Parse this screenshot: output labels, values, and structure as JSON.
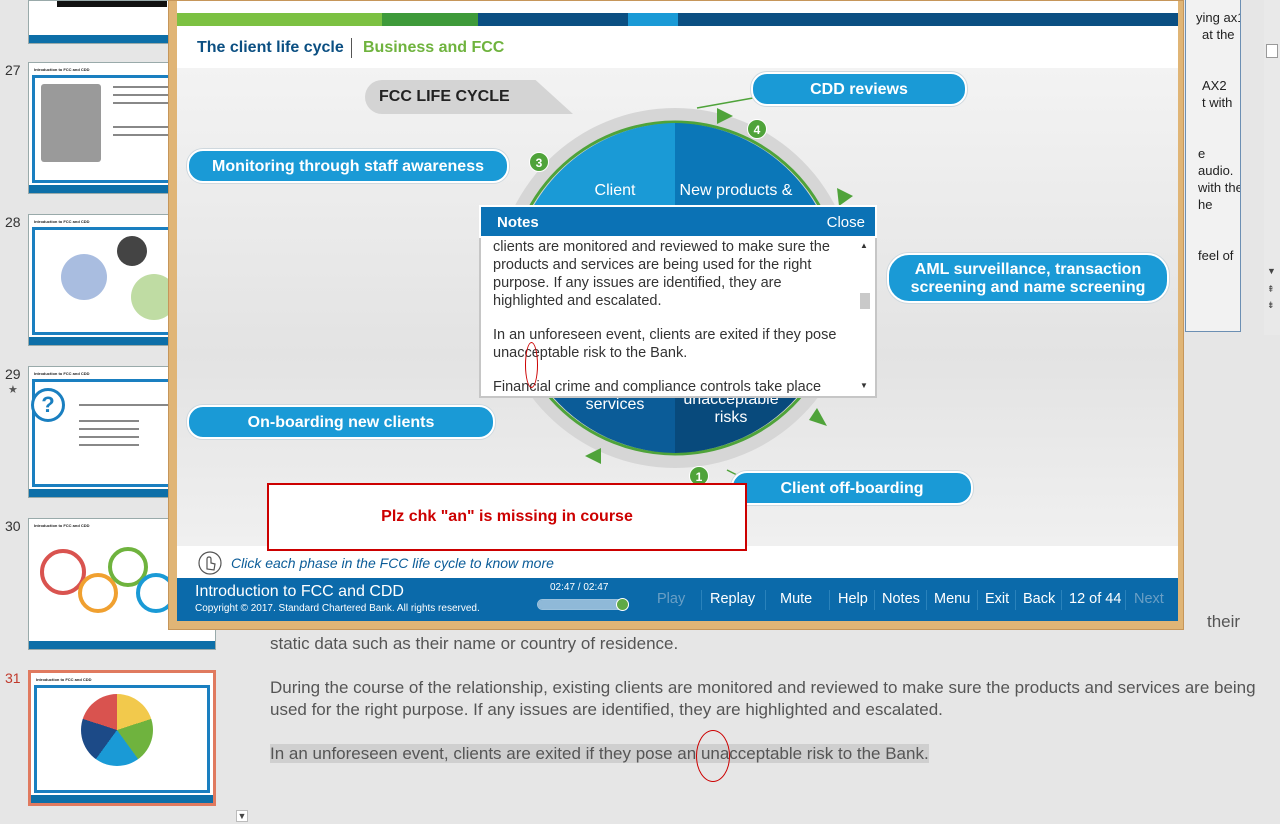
{
  "sidebar": {
    "slides": [
      {
        "number": "27",
        "title": "Introduction to FCC and CDD",
        "subtitle": "Importance of FCC: What is FCC?"
      },
      {
        "number": "28",
        "title": "Introduction to FCC and CDD",
        "subtitle": "Importance of FCC: What is FCC?"
      },
      {
        "number": "29",
        "title": "Introduction to FCC and CDD",
        "subtitle": "Importance of FCC: Knowledge check"
      },
      {
        "number": "30",
        "title": "Introduction to FCC and CDD",
        "subtitle": "Module introduction Home page"
      },
      {
        "number": "31",
        "title": "Introduction to FCC and CDD",
        "subtitle": "The client life cycle: Business and FCC"
      }
    ],
    "star": "★"
  },
  "right_text": [
    "ying ax1",
    "at the",
    "AX2",
    "t with",
    "e",
    "audio.",
    "with the",
    "he",
    "feel of"
  ],
  "notes_pane": {
    "frag_the": "the",
    "frag_their": "their",
    "line_static": "static data such as  their name or country of residence.",
    "para_during": "During the course of the relationship, existing clients are monitored and reviewed to make sure the products and services are being used for the right purpose. If any issues are identified, they are highlighted and escalated.",
    "para_unforeseen": "In an unforeseen event, clients are exited if they pose an unacceptable risk to the Bank."
  },
  "header": {
    "title": "The client life cycle",
    "subtitle": "Business and FCC"
  },
  "wheel": {
    "label": "FCC LIFE CYCLE",
    "phases": {
      "cdd_reviews": "CDD reviews",
      "monitoring": "Monitoring through staff awareness",
      "aml_line1": "AML surveillance, transaction",
      "aml_line2": "screening and name screening",
      "onboarding": "On-boarding new clients",
      "offboarding": "Client off-boarding"
    },
    "segments": {
      "client": "Client",
      "new_products": "New products &",
      "services": "services",
      "risks_line1": "unacceptable",
      "risks_line2": "risks"
    },
    "badges": [
      "1",
      "3",
      "4"
    ]
  },
  "notes_popup": {
    "title": "Notes",
    "close": "Close",
    "para1": "clients are monitored and reviewed to make sure the products and services are being used for the right purpose. If any issues are identified, they are highlighted and escalated.",
    "para2": "In an unforeseen event, clients are exited if they pose unacceptable risk to the Bank.",
    "para3": "Financial crime and compliance controls take place"
  },
  "annotation": {
    "callout": "Plz chk \"an\" is missing in course"
  },
  "hint": {
    "text": "Click each phase in the FCC life cycle to know more"
  },
  "controls": {
    "course_title": "Introduction to FCC and CDD",
    "copyright": "Copyright © 2017. Standard Chartered Bank. All rights reserved.",
    "time": "02:47 / 02:47",
    "progress": 1.0,
    "play": "Play",
    "replay": "Replay",
    "mute": "Mute",
    "help": "Help",
    "notes": "Notes",
    "menu": "Menu",
    "exit": "Exit",
    "back": "Back",
    "page": "12 of 44",
    "next": "Next"
  },
  "colors": {
    "brand_blue": "#0b6aaa",
    "phase_blue": "#1a9ad6",
    "brand_green": "#6fb33e",
    "annotation_red": "#cc0000"
  }
}
